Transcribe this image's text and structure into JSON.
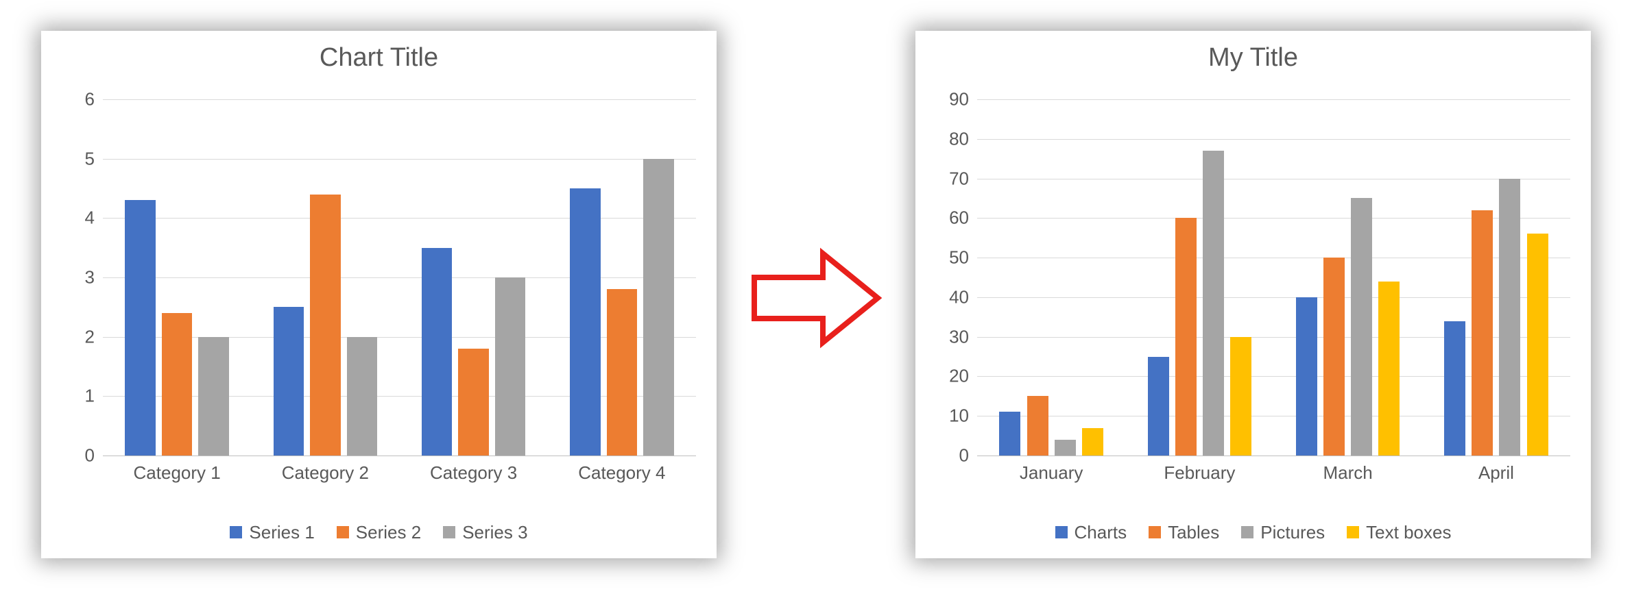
{
  "colors": {
    "blue": "#4472C4",
    "orange": "#ED7D31",
    "gray": "#A5A5A5",
    "yellow": "#FFC000",
    "arrow": "#E8201C"
  },
  "arrow_name": "arrow-right-icon",
  "chart_data": [
    {
      "id": "left",
      "type": "bar",
      "title": "Chart Title",
      "categories": [
        "Category 1",
        "Category 2",
        "Category 3",
        "Category 4"
      ],
      "series": [
        {
          "name": "Series 1",
          "color": "blue",
          "values": [
            4.3,
            2.5,
            3.5,
            4.5
          ]
        },
        {
          "name": "Series 2",
          "color": "orange",
          "values": [
            2.4,
            4.4,
            1.8,
            2.8
          ]
        },
        {
          "name": "Series 3",
          "color": "gray",
          "values": [
            2.0,
            2.0,
            3.0,
            5.0
          ]
        }
      ],
      "xlabel": "",
      "ylabel": "",
      "ylim": [
        0,
        6
      ],
      "ystep": 1
    },
    {
      "id": "right",
      "type": "bar",
      "title": "My Title",
      "categories": [
        "January",
        "February",
        "March",
        "April"
      ],
      "series": [
        {
          "name": "Charts",
          "color": "blue",
          "values": [
            11,
            25,
            40,
            34
          ]
        },
        {
          "name": "Tables",
          "color": "orange",
          "values": [
            15,
            60,
            50,
            62
          ]
        },
        {
          "name": "Pictures",
          "color": "gray",
          "values": [
            4,
            77,
            65,
            70
          ]
        },
        {
          "name": "Text boxes",
          "color": "yellow",
          "values": [
            7,
            30,
            44,
            56
          ]
        }
      ],
      "xlabel": "",
      "ylabel": "",
      "ylim": [
        0,
        90
      ],
      "ystep": 10
    }
  ]
}
